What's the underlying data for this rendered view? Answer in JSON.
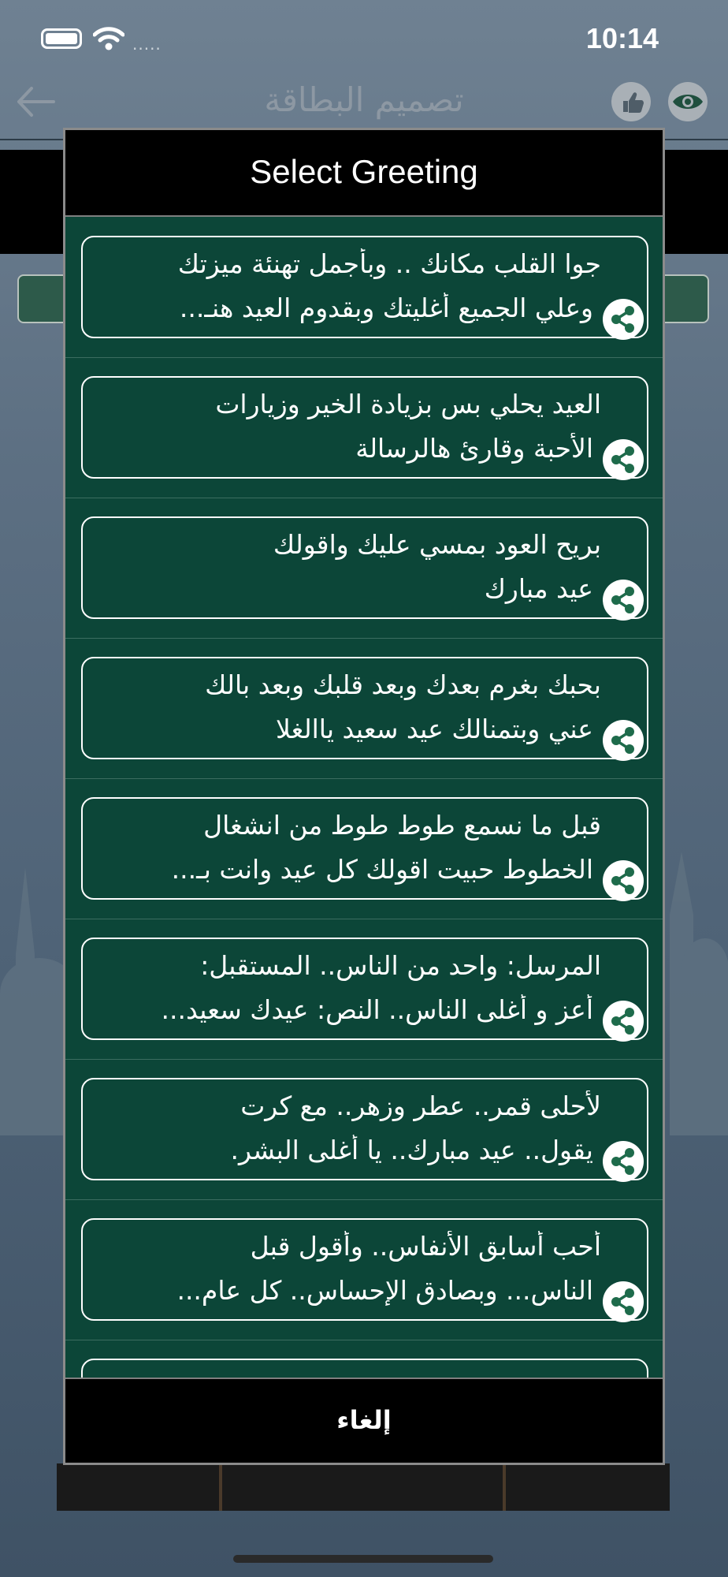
{
  "status_bar": {
    "time": "10:14",
    "carrier_dots": "....."
  },
  "nav": {
    "title": "تصميم البطاقة"
  },
  "dialog": {
    "title": "Select Greeting",
    "cancel_label": "إلغاء",
    "items": [
      {
        "line1": "جوا القلب مكانك .. وبأجمل تهنئة ميزتك",
        "line2": "وعلي الجميع أغليتك وبقدوم العيد هنـ..."
      },
      {
        "line1": "العيد يحلي بس بزيادة الخير وزيارات",
        "line2": "الأحبة وقارئ هالرسالة"
      },
      {
        "line1": "بريح العود بمسي عليك واقولك",
        "line2": "عيد مبارك"
      },
      {
        "line1": "بحبك بغرم بعدك وبعد قلبك وبعد بالك",
        "line2": "عني وبتمنالك عيد سعيد ياالغلا"
      },
      {
        "line1": "قبل ما نسمع طوط طوط من انشغال",
        "line2": "الخطوط حبيت اقولك كل عيد وانت بـ..."
      },
      {
        "line1": "المرسل: واحد من الناس.. المستقبل:",
        "line2": "أعز و أغلى الناس.. النص: عيدك سعيد..."
      },
      {
        "line1": "لأحلى قمر.. عطر وزهر.. مع كرت",
        "line2": "يقول.. عيد مبارك.. يا أغلى البشر."
      },
      {
        "line1": "أحب أسابق الأنفاس.. وأقول قبل",
        "line2": "الناس... وبصادق الإحساس.. كل عام..."
      }
    ]
  },
  "colors": {
    "dialog_bg": "#0c4638",
    "header_bg": "#000000",
    "accent_green": "#1e6b4b"
  }
}
